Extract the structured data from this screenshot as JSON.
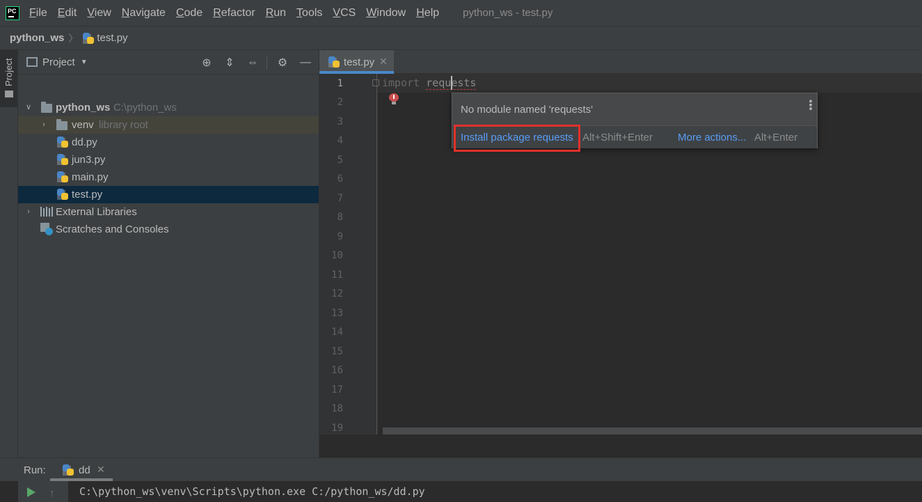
{
  "menubar": {
    "items": [
      "File",
      "Edit",
      "View",
      "Navigate",
      "Code",
      "Refactor",
      "Run",
      "Tools",
      "VCS",
      "Window",
      "Help"
    ],
    "window_title": "python_ws - test.py",
    "logo_text": "PC"
  },
  "breadcrumb": {
    "root": "python_ws",
    "file": "test.py"
  },
  "toolstrip": {
    "project_label": "Project"
  },
  "project_panel": {
    "title": "Project",
    "tree": {
      "root_name": "python_ws",
      "root_path": "C:\\python_ws",
      "venv_name": "venv",
      "venv_note": "library root",
      "files": [
        "dd.py",
        "jun3.py",
        "main.py",
        "test.py"
      ],
      "external_libraries": "External Libraries",
      "scratches": "Scratches and Consoles"
    }
  },
  "editor": {
    "tab_label": "test.py",
    "tab_close": "✕",
    "line_numbers": [
      "1",
      "2",
      "3",
      "4",
      "5",
      "6",
      "7",
      "8",
      "9",
      "10",
      "11",
      "12",
      "13",
      "14",
      "15",
      "16",
      "17",
      "18",
      "19"
    ],
    "code_keyword": "import",
    "code_module": "requests"
  },
  "popup": {
    "message": "No module named 'requests'",
    "primary_action": "Install package requests",
    "primary_shortcut": "Alt+Shift+Enter",
    "more_actions": "More actions...",
    "more_shortcut": "Alt+Enter"
  },
  "run": {
    "label": "Run:",
    "tab_label": "dd",
    "tab_close": "✕",
    "command": "C:\\python_ws\\venv\\Scripts\\python.exe C:/python_ws/dd.py"
  },
  "colors": {
    "link": "#589df6",
    "highlight_border": "#e0312a",
    "tab_accent": "#4a88c7",
    "run_play": "#59a869"
  }
}
